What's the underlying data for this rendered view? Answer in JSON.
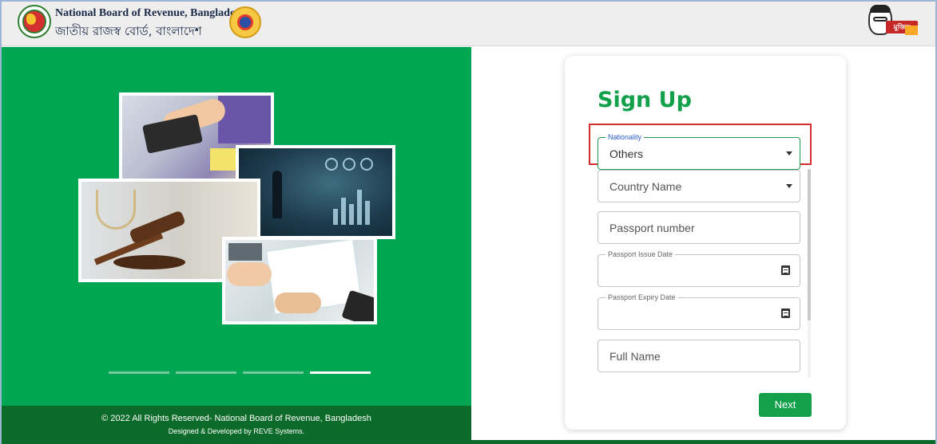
{
  "header": {
    "brand_en": "National Board of Revenue, Bangladesh",
    "brand_bn": "জাতীয় রাজস্ব বোর্ড, বাংলাদেশ",
    "logos": [
      "nbr-emblem-icon",
      "customs-emblem-icon",
      "mujib-100-logo"
    ],
    "mujib_badge": "মুজিব"
  },
  "hero": {
    "images": [
      "calculator-photo",
      "business-chart-photo",
      "gavel-photo",
      "accounting-photo"
    ],
    "indicators": [
      {
        "active": false
      },
      {
        "active": false
      },
      {
        "active": false
      },
      {
        "active": true
      }
    ],
    "footer": {
      "copyright": "© 2022 All Rights Reserved- National Board of Revenue, Bangladesh",
      "credit": "Designed & Developed by REVE Systems."
    }
  },
  "form": {
    "title": "Sign Up",
    "nationality": {
      "label": "Nationality",
      "value": "Others"
    },
    "country": {
      "placeholder": "Country Name"
    },
    "passport_number": {
      "placeholder": "Passport number"
    },
    "passport_issue_date": {
      "label": "Passport Issue Date",
      "value": ""
    },
    "passport_expiry_date": {
      "label": "Passport Expiry Date",
      "value": ""
    },
    "full_name": {
      "placeholder": "Full Name"
    },
    "next_label": "Next"
  },
  "colors": {
    "brand_green": "#00a651",
    "dark_green": "#0c6b29",
    "accent_green": "#13a04a",
    "highlight_red": "#d32f2f"
  }
}
